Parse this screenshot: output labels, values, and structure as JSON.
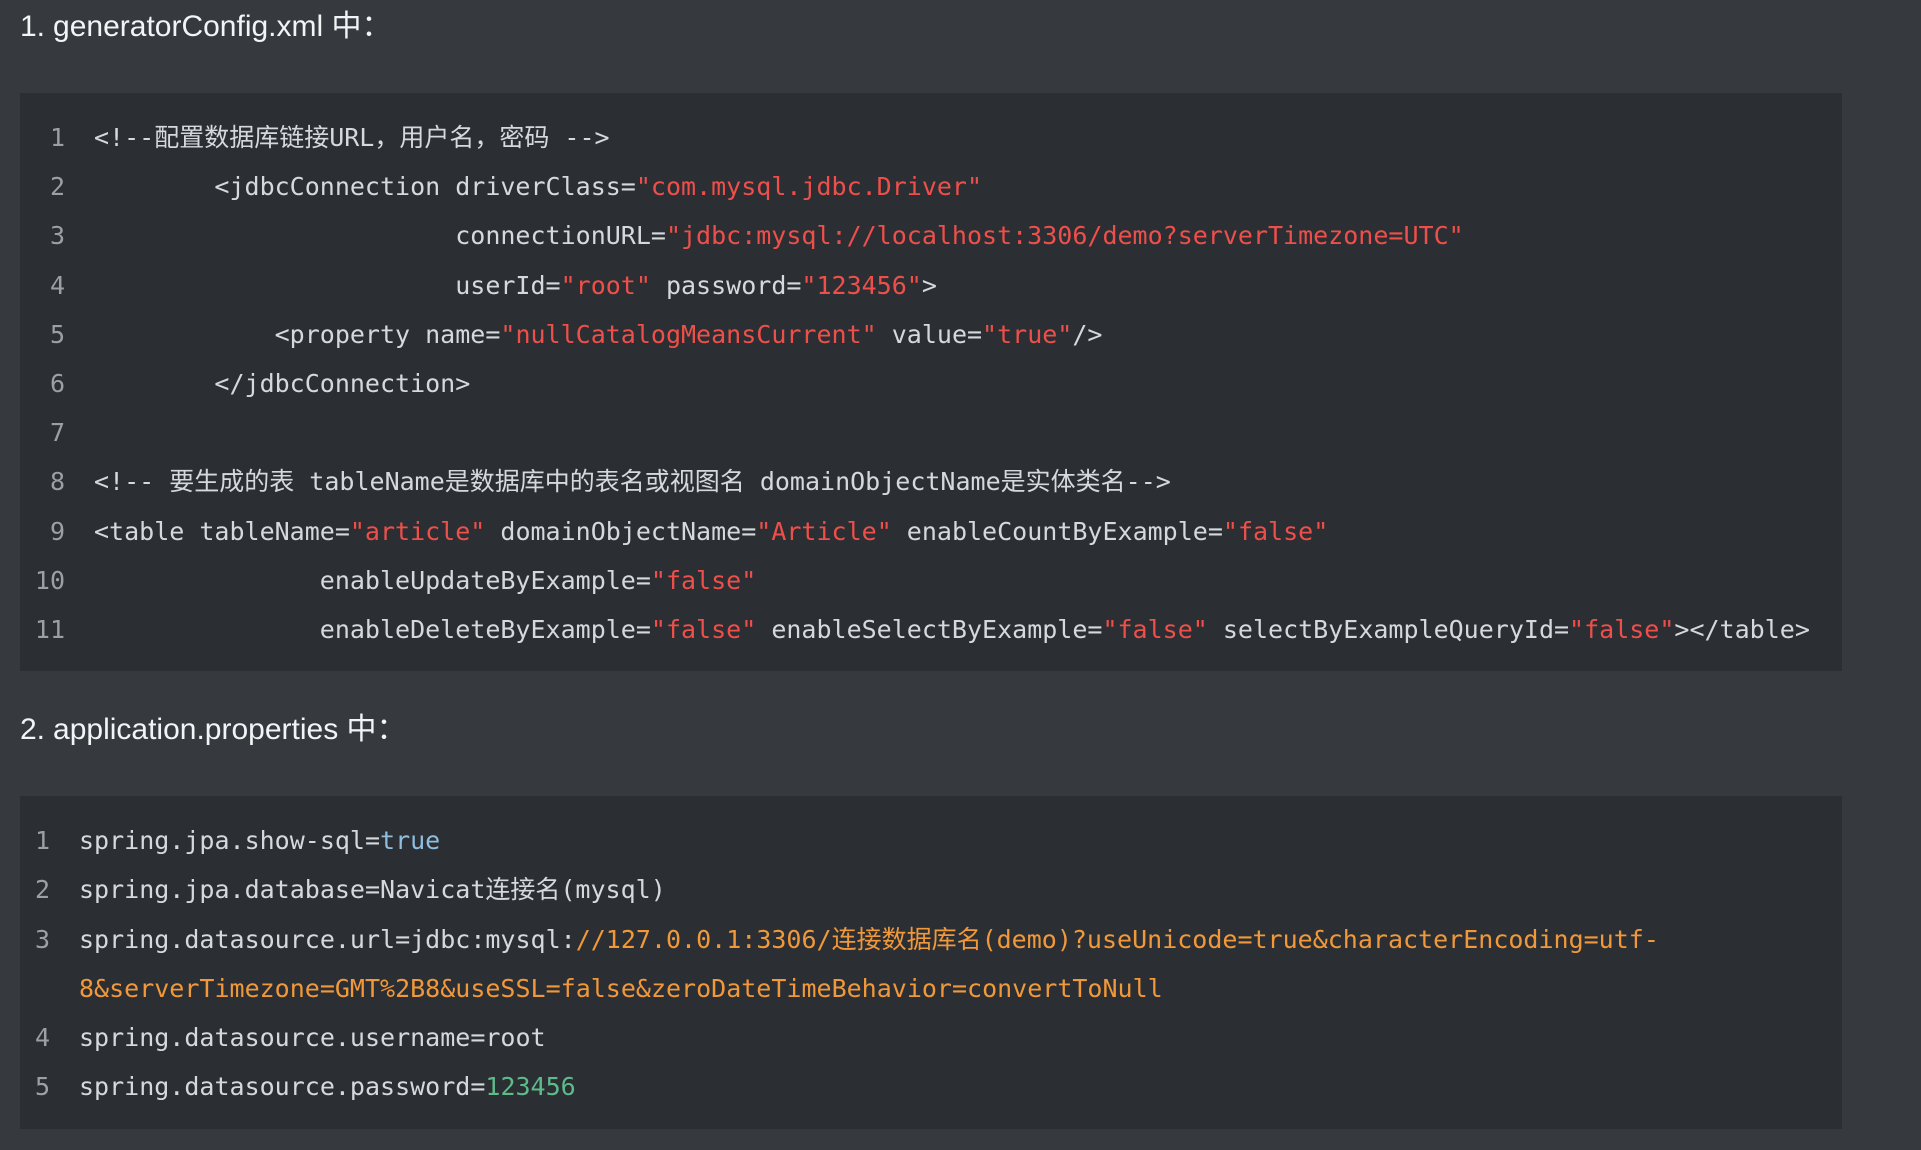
{
  "headings": {
    "first": {
      "number": "1.",
      "text": "generatorConfig.xml 中："
    },
    "second": {
      "number": "2.",
      "text": "application.properties 中："
    }
  },
  "xml_block": {
    "lines": [
      {
        "n": "1",
        "parts": [
          {
            "t": "<!--配置数据库链接URL，用户名，密码 -->",
            "c": "plain"
          }
        ]
      },
      {
        "n": "2",
        "parts": [
          {
            "t": "        <jdbcConnection driverClass=",
            "c": "plain"
          },
          {
            "t": "\"com.mysql.jdbc.Driver\"",
            "c": "str"
          }
        ]
      },
      {
        "n": "3",
        "parts": [
          {
            "t": "                        connectionURL=",
            "c": "plain"
          },
          {
            "t": "\"jdbc:mysql://localhost:3306/demo?serverTimezone=UTC\"",
            "c": "str"
          }
        ]
      },
      {
        "n": "4",
        "parts": [
          {
            "t": "                        userId=",
            "c": "plain"
          },
          {
            "t": "\"root\"",
            "c": "str"
          },
          {
            "t": " password=",
            "c": "plain"
          },
          {
            "t": "\"123456\"",
            "c": "str"
          },
          {
            "t": ">",
            "c": "plain"
          }
        ]
      },
      {
        "n": "5",
        "parts": [
          {
            "t": "            <property name=",
            "c": "plain"
          },
          {
            "t": "\"nullCatalogMeansCurrent\"",
            "c": "str"
          },
          {
            "t": " value=",
            "c": "plain"
          },
          {
            "t": "\"true\"",
            "c": "str"
          },
          {
            "t": "/>",
            "c": "plain"
          }
        ]
      },
      {
        "n": "6",
        "parts": [
          {
            "t": "        </jdbcConnection>",
            "c": "plain"
          }
        ]
      },
      {
        "n": "7",
        "parts": [
          {
            "t": "",
            "c": "plain"
          }
        ]
      },
      {
        "n": "8",
        "parts": [
          {
            "t": "<!-- 要生成的表 tableName是数据库中的表名或视图名 domainObjectName是实体类名-->",
            "c": "plain"
          }
        ]
      },
      {
        "n": "9",
        "parts": [
          {
            "t": "<table tableName=",
            "c": "plain"
          },
          {
            "t": "\"article\"",
            "c": "str"
          },
          {
            "t": " domainObjectName=",
            "c": "plain"
          },
          {
            "t": "\"Article\"",
            "c": "str"
          },
          {
            "t": " enableCountByExample=",
            "c": "plain"
          },
          {
            "t": "\"false\"",
            "c": "str"
          }
        ]
      },
      {
        "n": "10",
        "parts": [
          {
            "t": "               enableUpdateByExample=",
            "c": "plain"
          },
          {
            "t": "\"false\"",
            "c": "str"
          }
        ]
      },
      {
        "n": "11",
        "parts": [
          {
            "t": "               enableDeleteByExample=",
            "c": "plain"
          },
          {
            "t": "\"false\"",
            "c": "str"
          },
          {
            "t": " enableSelectByExample=",
            "c": "plain"
          },
          {
            "t": "\"false\"",
            "c": "str"
          },
          {
            "t": " selectByExampleQueryId=",
            "c": "plain"
          },
          {
            "t": "\"false\"",
            "c": "str"
          },
          {
            "t": "></table>",
            "c": "plain"
          }
        ]
      }
    ]
  },
  "properties_block": {
    "lines": [
      {
        "n": "1",
        "parts": [
          {
            "t": "spring.jpa.show-sql=",
            "c": "plain"
          },
          {
            "t": "true",
            "c": "blue"
          }
        ]
      },
      {
        "n": "2",
        "parts": [
          {
            "t": "spring.jpa.database=Navicat连接名(mysql)",
            "c": "plain"
          }
        ]
      },
      {
        "n": "3",
        "parts": [
          {
            "t": "spring.datasource.url=jdbc:mysql:",
            "c": "plain"
          },
          {
            "t": "//127.0.0.1:3306/连接数据库名(demo)?useUnicode=true&characterEncoding=utf-",
            "c": "orange"
          }
        ]
      },
      {
        "n": "",
        "parts": [
          {
            "t": "8&serverTimezone=GMT%2B8&useSSL=false&zeroDateTimeBehavior=convertToNull",
            "c": "orange"
          }
        ]
      },
      {
        "n": "4",
        "parts": [
          {
            "t": "spring.datasource.username=root",
            "c": "plain"
          }
        ]
      },
      {
        "n": "5",
        "parts": [
          {
            "t": "spring.datasource.password=",
            "c": "plain"
          },
          {
            "t": "123456",
            "c": "green"
          }
        ]
      }
    ]
  },
  "colors": {
    "page_background": "#363a3f",
    "code_background": "#2b2f33",
    "string": "#ef4f4a",
    "url": "#f0983a",
    "boolean": "#8fbde0",
    "number": "#5dbb8a"
  }
}
